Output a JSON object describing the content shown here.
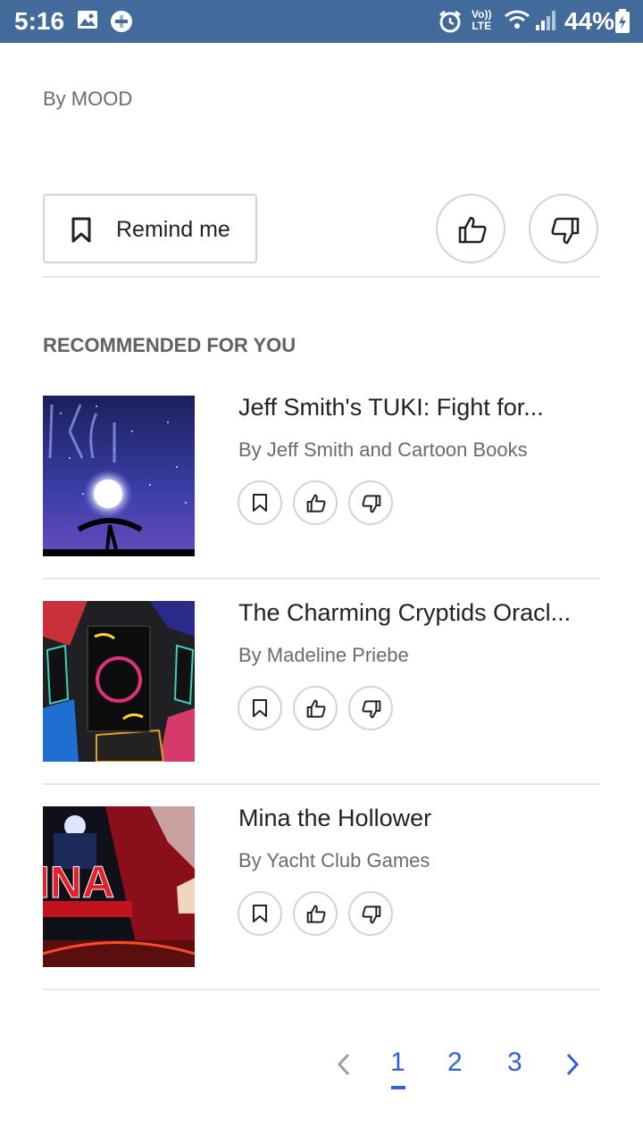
{
  "status_bar": {
    "time": "5:16",
    "lte_top": "Vo))",
    "lte_bottom": "LTE",
    "battery": "44%"
  },
  "header": {
    "byline": "By MOOD"
  },
  "actions": {
    "remind_label": "Remind me"
  },
  "recommended": {
    "heading": "RECOMMENDED FOR YOU",
    "items": [
      {
        "title": "Jeff Smith's TUKI: Fight for...",
        "author": "By Jeff Smith and Cartoon Books"
      },
      {
        "title": "The Charming Cryptids Oracl...",
        "author": "By Madeline Priebe"
      },
      {
        "title": "Mina the Hollower",
        "author": "By Yacht Club Games"
      }
    ]
  },
  "pagination": {
    "pages": [
      "1",
      "2",
      "3"
    ],
    "current": "1"
  },
  "colors": {
    "status_bar": "#426a9a",
    "accent": "#2f63d6",
    "border": "#d3d3d3"
  }
}
